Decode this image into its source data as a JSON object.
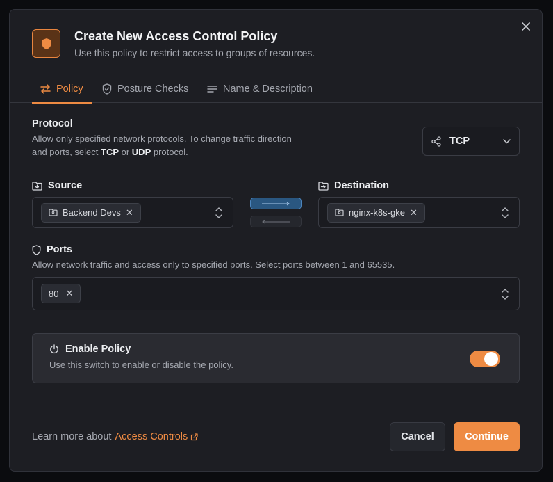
{
  "dialog": {
    "title": "Create New Access Control Policy",
    "subtitle": "Use this policy to restrict access to groups of resources."
  },
  "tabs": [
    {
      "label": "Policy",
      "active": true,
      "icon": "arrows-exchange-icon"
    },
    {
      "label": "Posture Checks",
      "active": false,
      "icon": "shield-check-icon"
    },
    {
      "label": "Name & Description",
      "active": false,
      "icon": "text-lines-icon"
    }
  ],
  "protocol": {
    "label": "Protocol",
    "help_part1": "Allow only specified network protocols. To change traffic direction and ports, select ",
    "tcp": "TCP",
    "or": " or ",
    "udp": "UDP",
    "help_part2": " protocol.",
    "selected": "TCP"
  },
  "source": {
    "label": "Source",
    "chips": [
      "Backend Devs"
    ]
  },
  "destination": {
    "label": "Destination",
    "chips": [
      "nginx-k8s-gke"
    ]
  },
  "direction": {
    "forward_active": true,
    "backward_active": false
  },
  "ports": {
    "label": "Ports",
    "help": "Allow network traffic and access only to specified ports. Select ports between 1 and 65535.",
    "chips": [
      "80"
    ]
  },
  "enable_policy": {
    "label": "Enable Policy",
    "help": "Use this switch to enable or disable the policy.",
    "enabled": true
  },
  "footer": {
    "learn_prefix": "Learn more about",
    "learn_link": "Access Controls",
    "cancel": "Cancel",
    "continue": "Continue"
  },
  "colors": {
    "accent": "#ee8b43",
    "direction_active": "#2a5781",
    "surface": "#1d1e23"
  }
}
